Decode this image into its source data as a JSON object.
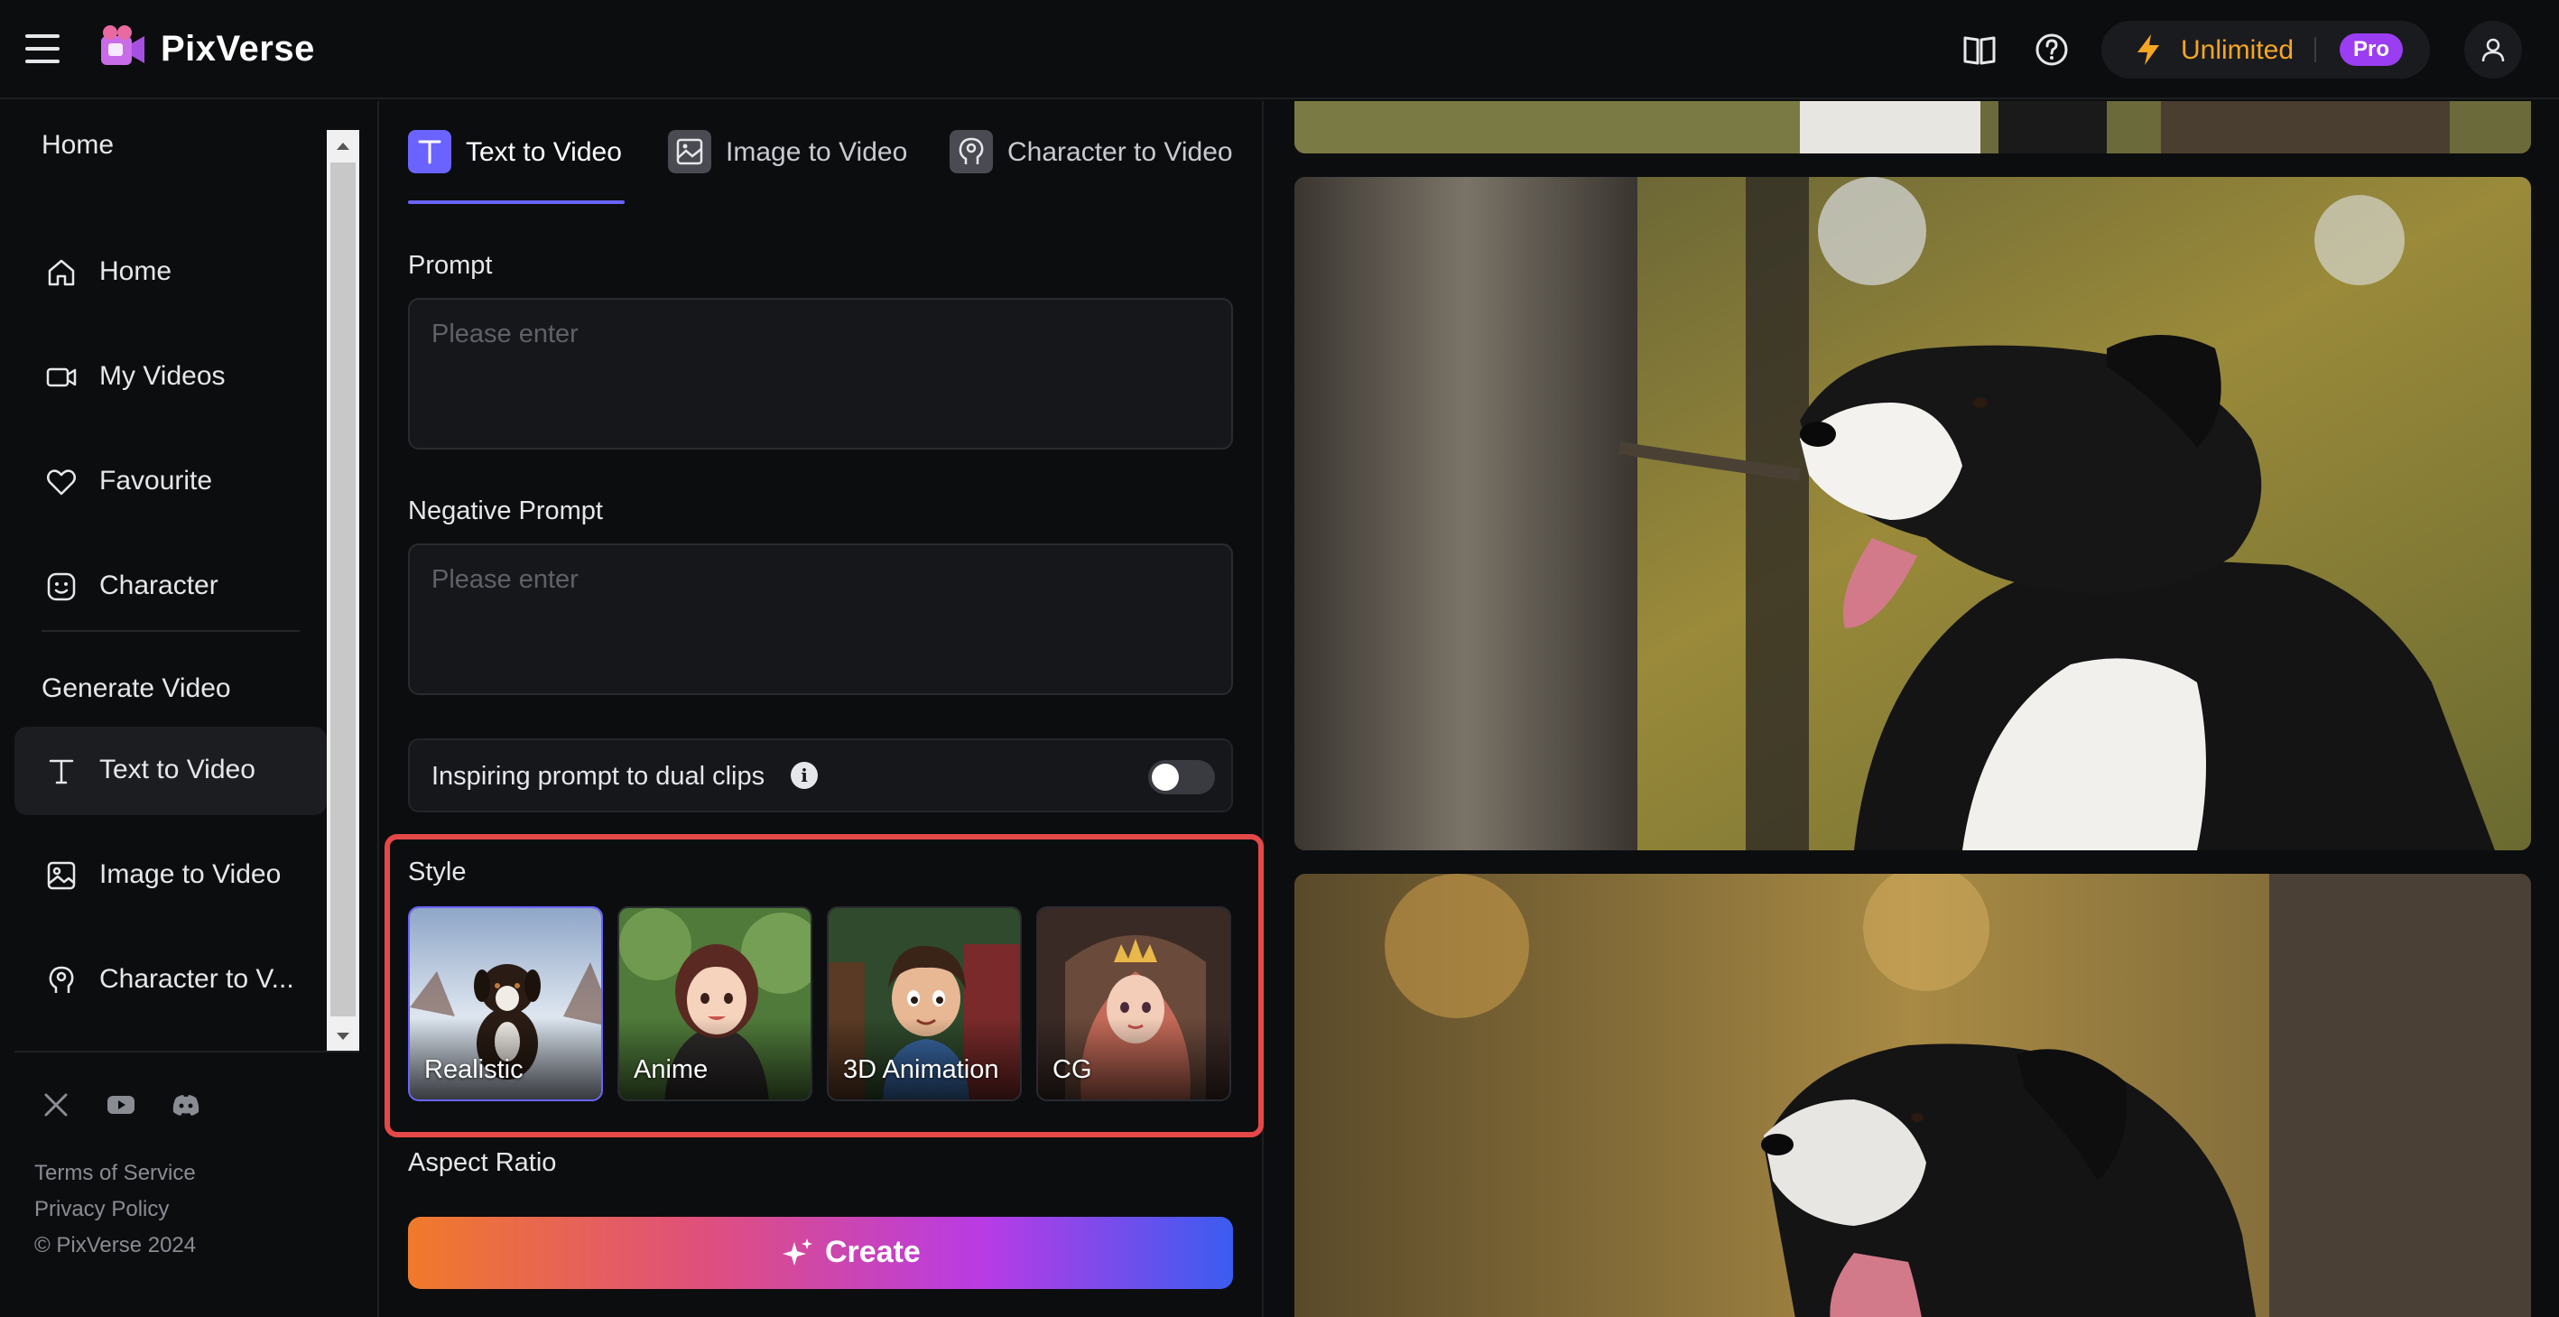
{
  "app": {
    "name": "PixVerse"
  },
  "topbar": {
    "plan_label": "Unlimited",
    "plan_badge": "Pro"
  },
  "sidebar": {
    "section_home": "Home",
    "items_home": [
      {
        "label": "Home",
        "icon": "home-icon"
      },
      {
        "label": "My Videos",
        "icon": "video-camera-icon"
      },
      {
        "label": "Favourite",
        "icon": "heart-icon"
      },
      {
        "label": "Character",
        "icon": "smiley-icon"
      }
    ],
    "section_generate": "Generate Video",
    "items_generate": [
      {
        "label": "Text to Video",
        "icon": "text-t-icon",
        "active": true
      },
      {
        "label": "Image to Video",
        "icon": "image-icon"
      },
      {
        "label": "Character to V...",
        "icon": "character-head-icon"
      }
    ],
    "footer_links": [
      "Terms of Service",
      "Privacy Policy",
      "© PixVerse 2024"
    ]
  },
  "tabs": [
    {
      "label": "Text to Video",
      "active": true
    },
    {
      "label": "Image to Video"
    },
    {
      "label": "Character to Video"
    }
  ],
  "form": {
    "prompt_label": "Prompt",
    "prompt_placeholder": "Please enter",
    "negative_label": "Negative Prompt",
    "negative_placeholder": "Please enter",
    "dual_clips_label": "Inspiring prompt to dual clips",
    "dual_clips_enabled": false,
    "style_label": "Style",
    "styles": [
      {
        "name": "Realistic",
        "selected": true
      },
      {
        "name": "Anime"
      },
      {
        "name": "3D Animation"
      },
      {
        "name": "CG"
      }
    ],
    "aspect_label": "Aspect Ratio",
    "create_label": "Create"
  },
  "colors": {
    "accent": "#6b63ff",
    "plan": "#f5a623",
    "pro_badge": "#9b3df2",
    "highlight_border": "#e54848"
  }
}
